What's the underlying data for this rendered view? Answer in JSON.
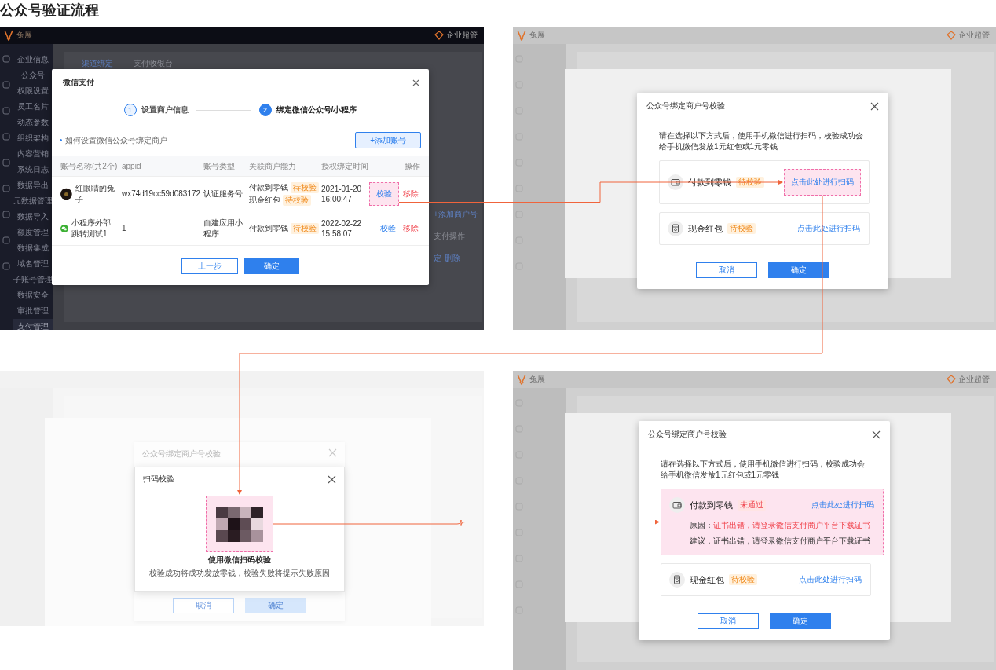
{
  "title": "公众号验证流程",
  "screens": [
    {
      "kind": "bind_list",
      "app": {
        "logo": "兔展",
        "user": "企业超管",
        "menu": [
          {
            "label": "企业信息",
            "selected": false
          },
          {
            "label": "公众号",
            "selected": false
          },
          {
            "label": "权限设置",
            "selected": false
          },
          {
            "label": "员工名片",
            "selected": false
          },
          {
            "label": "动态参数",
            "selected": false
          },
          {
            "label": "组织架构",
            "selected": false
          },
          {
            "label": "内容营销",
            "selected": false
          },
          {
            "label": "系统日志",
            "selected": false
          },
          {
            "label": "数据导出",
            "selected": false
          },
          {
            "label": "元数据管理",
            "selected": false
          },
          {
            "label": "数据导入",
            "selected": false
          },
          {
            "label": "额度管理",
            "selected": false
          },
          {
            "label": "数据集成",
            "selected": false
          },
          {
            "label": "域名管理",
            "selected": false
          },
          {
            "label": "子账号管理",
            "selected": false
          },
          {
            "label": "数据安全",
            "selected": false
          },
          {
            "label": "审批管理",
            "selected": false
          },
          {
            "label": "支付管理",
            "selected": true
          }
        ],
        "tabs": [
          {
            "label": "渠道绑定",
            "selected": true
          },
          {
            "label": "支付收银台",
            "selected": false
          }
        ],
        "side_items": [
          {
            "kind": "link",
            "label": "+添加商户号"
          },
          {
            "kind": "text",
            "label": "支付操作"
          }
        ],
        "row_links": [
          "定",
          "删除"
        ]
      },
      "dialog": {
        "title": "微信支付",
        "steps": [
          {
            "number": "1",
            "label": "设置商户信息",
            "selected": false
          },
          {
            "number": "2",
            "label": "绑定微信公众号/小程序",
            "selected": true
          }
        ],
        "help_link": "如何设置微信公众号绑定商户",
        "add_button": "+添加账号",
        "columns": [
          "账号名称(共2个)",
          "appid",
          "账号类型",
          "关联商户能力",
          "授权绑定时间",
          "操作"
        ],
        "rows": [
          {
            "kind": "photo",
            "name": "红眼睛的兔子",
            "appid": "wx74d19cc59d083172",
            "type": "认证服务号",
            "abilities": [
              {
                "label": "付款到零钱",
                "status": "待校验"
              },
              {
                "label": "现金红包",
                "status": "待校验"
              }
            ],
            "date": "2021-01-20",
            "time": "16:00:47",
            "verify": "校验",
            "remove": "移除",
            "highlighted": true
          },
          {
            "kind": "wechat",
            "name": "小程序外部跳转测试1",
            "appid": "1",
            "type": "自建应用小程序",
            "abilities": [
              {
                "label": "付款到零钱",
                "status": "待校验"
              }
            ],
            "date": "2022-02-22",
            "time": "15:58:07",
            "verify": "校验",
            "remove": "移除",
            "highlighted": false
          }
        ],
        "buttons": [
          "上一步",
          "确定"
        ]
      }
    },
    {
      "kind": "verify",
      "app": {
        "logo": "兔展",
        "user": "企业超管"
      },
      "dialog": {
        "title": "公众号绑定商户号校验",
        "intro": "请在选择以下方式后，使用手机微信进行扫码，校验成功会给手机微信发放1元红包或1元零钱",
        "options": [
          {
            "kind": "wallet",
            "label": "付款到零钱",
            "status": "待校验",
            "failed": false,
            "action": "点击此处进行扫码",
            "card_highlighted": false,
            "link_highlighted": true
          },
          {
            "kind": "envelope",
            "label": "现金红包",
            "status": "待校验",
            "failed": false,
            "action": "点击此处进行扫码",
            "card_highlighted": false,
            "link_highlighted": false
          }
        ],
        "buttons": [
          "取消",
          "确定"
        ]
      }
    },
    {
      "kind": "scan",
      "behind": {
        "title": "公众号绑定商户号校验",
        "buttons": [
          "取消",
          "确定"
        ]
      },
      "dialog": {
        "title": "扫码校验",
        "highlighted": true,
        "caption": "使用微信扫码校验",
        "note": "校验成功将成功发放零钱，校验失败将提示失败原因"
      }
    },
    {
      "kind": "verify_result",
      "app": {
        "logo": "兔展",
        "user": "企业超管"
      },
      "dialog": {
        "title": "公众号绑定商户号校验",
        "intro": "请在选择以下方式后，使用手机微信进行扫码，校验成功会给手机微信发放1元红包或1元零钱",
        "options": [
          {
            "kind": "wallet",
            "label": "付款到零钱",
            "status": "未通过",
            "failed": true,
            "action": "点击此处进行扫码",
            "card_highlighted": true,
            "link_highlighted": false,
            "reason_label": "原因：",
            "reason": "证书出错，请登录微信支付商户平台下载证书",
            "advice_label": "建议：",
            "advice": "证书出错，请登录微信支付商户平台下载证书"
          },
          {
            "kind": "envelope",
            "label": "现金红包",
            "status": "待校验",
            "failed": false,
            "action": "点击此处进行扫码",
            "card_highlighted": false,
            "link_highlighted": false
          }
        ],
        "buttons": [
          "取消",
          "确定"
        ]
      }
    }
  ]
}
